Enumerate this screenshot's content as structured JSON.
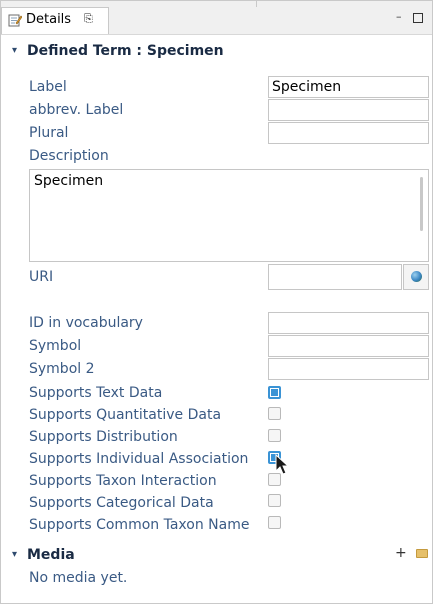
{
  "tab": {
    "label": "Details",
    "close": "⎘"
  },
  "window": {
    "minimize": "–"
  },
  "defined_term": {
    "title": "Defined Term : Specimen",
    "toggle": "▾",
    "label_text": "Label",
    "label_value": "Specimen",
    "abbrev_label": "abbrev. Label",
    "abbrev_value": "",
    "plural": "Plural",
    "plural_value": "",
    "description": "Description",
    "description_value": "Specimen",
    "uri": "URI",
    "uri_value": "",
    "id_in_vocabulary": "ID in vocabulary",
    "id_value": "",
    "symbol": "Symbol",
    "symbol_value": "",
    "symbol2": "Symbol 2",
    "symbol2_value": ""
  },
  "supports": [
    {
      "label": "Supports Text Data",
      "checked": true
    },
    {
      "label": "Supports Quantitative Data",
      "checked": false
    },
    {
      "label": "Supports Distribution",
      "checked": false
    },
    {
      "label": "Supports Individual Association",
      "checked": true
    },
    {
      "label": "Supports Taxon Interaction",
      "checked": false
    },
    {
      "label": "Supports Categorical Data",
      "checked": false
    },
    {
      "label": "Supports Common Taxon Name",
      "checked": false
    }
  ],
  "media": {
    "title": "Media",
    "toggle": "▾",
    "add": "+",
    "empty": "No media yet."
  }
}
